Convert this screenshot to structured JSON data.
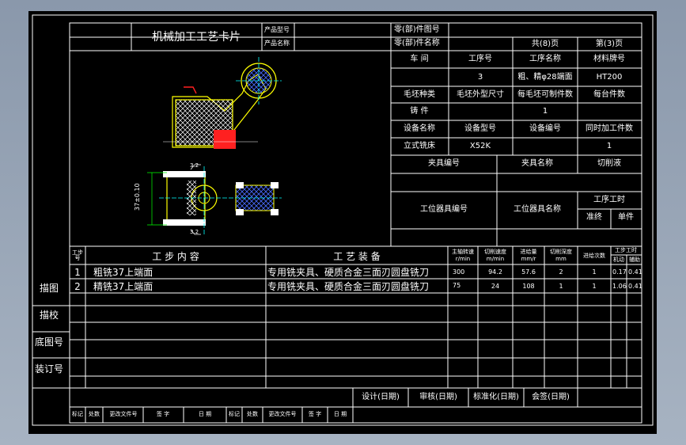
{
  "card": {
    "title": "机械加工工艺卡片",
    "product_model_label": "产品型号",
    "product_name_label": "产品名称",
    "part_drawing_label": "零(部)件图号",
    "part_name_label": "零(部)件名称",
    "total_pages": "共(8)页",
    "page_no": "第(3)页"
  },
  "info": {
    "workshop_label": "车 间",
    "op_no_label": "工序号",
    "op_name_label": "工序名称",
    "material_label": "材料牌号",
    "op_no": "3",
    "op_name": "粗、精φ28端面",
    "material": "HT200",
    "blank_type_label": "毛坯种类",
    "blank_size_label": "毛坯外型尺寸",
    "per_blank_label": "每毛坯可制件数",
    "per_unit_label": "每台件数",
    "casting_label": "铸 件",
    "per_blank": "1",
    "equip_name_label": "设备名称",
    "equip_model_label": "设备型号",
    "equip_no_label": "设备编号",
    "simul_label": "同时加工件数",
    "equip_name": "立式铣床",
    "equip_model": "X52K",
    "simul": "1",
    "fixture_no_label": "夹具编号",
    "fixture_name_label": "夹具名称",
    "coolant_label": "切削液",
    "station_tool_no_label": "工位器具编号",
    "station_tool_name_label": "工位器具名称",
    "op_time_label": "工序工时",
    "prep_label": "准终",
    "unit_label": "单件"
  },
  "drawing": {
    "dim_vertical": "37±0.10",
    "roughness_top": "3.2",
    "roughness_bottom": "3.2"
  },
  "steps_header": {
    "step_no": "工步号",
    "step_content": "工 步 内 容",
    "equipment": "工 艺 装 备",
    "spindle": "主轴转速",
    "spindle_unit": "r/min",
    "cut_speed": "切削速度",
    "cut_speed_unit": "m/min",
    "feed": "进给量",
    "feed_unit": "mm/r",
    "depth": "切削深度",
    "depth_unit": "mm",
    "passes": "进给次数",
    "step_time": "工步工时",
    "machine": "机动",
    "aux": "辅助"
  },
  "steps": [
    {
      "no": "1",
      "content": "粗铣37上端面",
      "equipment": "专用铣夹具、硬质合金三面刃圆盘铣刀",
      "spindle": "300",
      "speed": "94.2",
      "feed": "57.6",
      "depth": "2",
      "passes": "1",
      "machine": "0.17",
      "aux": "0.41"
    },
    {
      "no": "2",
      "content": "精铣37上端面",
      "equipment": "专用铣夹具、硬质合金三面刃圆盘铣刀",
      "spindle": "75",
      "speed": "24",
      "feed": "108",
      "depth": "1",
      "passes": "1",
      "machine": "1.06",
      "aux": "0.41"
    }
  ],
  "side_labels": {
    "draw": "描图",
    "trace": "描校",
    "base_no": "底图号",
    "bind_no": "装订号"
  },
  "footer": {
    "design": "设计(日期)",
    "review": "审核(日期)",
    "standard": "标准化(日期)",
    "sign": "会签(日期)",
    "mark": "标记",
    "count": "处数",
    "change_doc": "更改文件号",
    "signature": "签 字",
    "date": "日 期"
  }
}
